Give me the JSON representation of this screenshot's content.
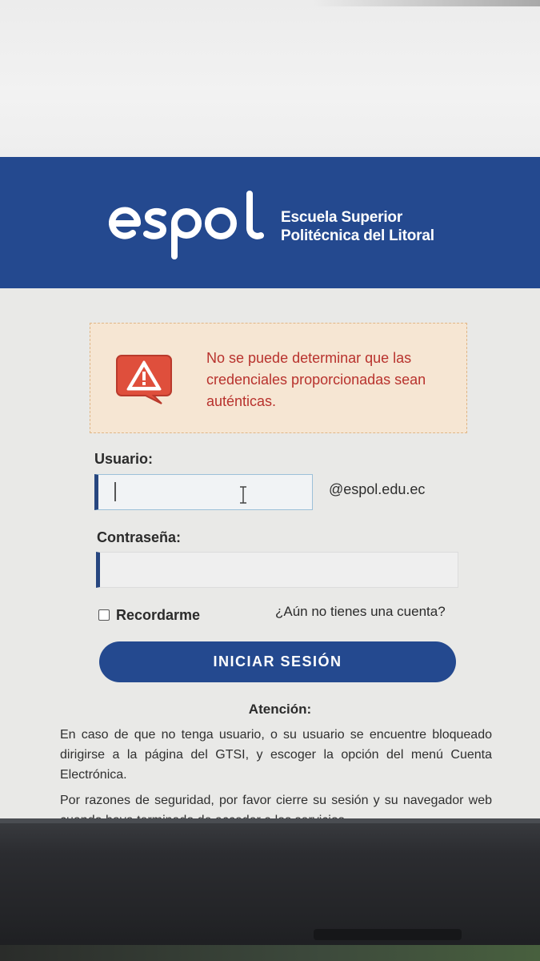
{
  "header": {
    "logo_word": "espol",
    "institution_line1": "Escuela Superior",
    "institution_line2": "Politécnica del Litoral"
  },
  "alert": {
    "message": "No se puede determinar que las credenciales proporcionadas sean auténticas.",
    "icon": "warning-icon",
    "text_color": "#b8322d",
    "background_color": "#f6e6d3"
  },
  "form": {
    "username_label": "Usuario:",
    "username_value": "",
    "username_suffix": "@espol.edu.ec",
    "password_label": "Contraseña:",
    "password_value": "",
    "remember_label": "Recordarme",
    "remember_checked": false,
    "register_link": "¿Aún no tienes una cuenta?",
    "submit_label": "INICIAR SESIÓN"
  },
  "notice": {
    "title": "Atención:",
    "paragraph1": "En caso de que no tenga usuario, o su usuario se encuentre bloqueado dirigirse a la página del GTSI, y escoger la opción del menú Cuenta Electrónica.",
    "paragraph2": "Por razones de seguridad, por favor cierre su sesión y su navegador web cuando haya terminado de acceder a los servicios"
  },
  "colors": {
    "brand_blue": "#24498f",
    "page_background": "#e9e9e7"
  }
}
